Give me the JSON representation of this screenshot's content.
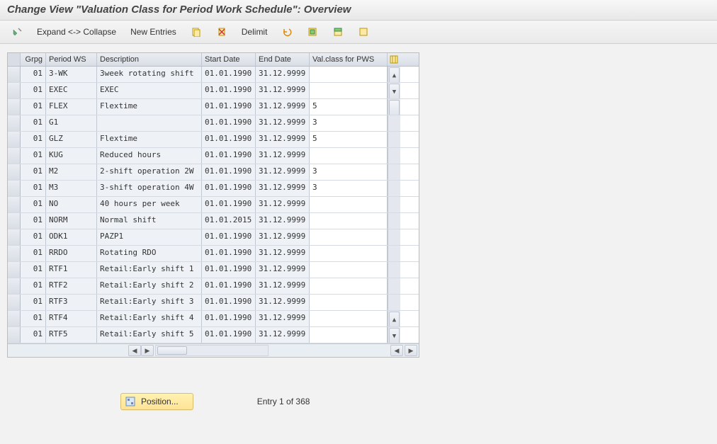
{
  "title": "Change View \"Valuation Class for Period Work Schedule\": Overview",
  "toolbar": {
    "expand_collapse": "Expand <-> Collapse",
    "new_entries": "New Entries",
    "delimit": "Delimit"
  },
  "columns": {
    "grpg": "Grpg",
    "period_ws": "Period WS",
    "description": "Description",
    "start_date": "Start Date",
    "end_date": "End Date",
    "val_class": "Val.class for PWS"
  },
  "rows": [
    {
      "grpg": "01",
      "pws": "3-WK",
      "desc": "3week rotating shift",
      "start": "01.01.1990",
      "end": "31.12.9999",
      "val": ""
    },
    {
      "grpg": "01",
      "pws": "EXEC",
      "desc": "EXEC",
      "start": "01.01.1990",
      "end": "31.12.9999",
      "val": ""
    },
    {
      "grpg": "01",
      "pws": "FLEX",
      "desc": "Flextime",
      "start": "01.01.1990",
      "end": "31.12.9999",
      "val": "5"
    },
    {
      "grpg": "01",
      "pws": "G1",
      "desc": "",
      "start": "01.01.1990",
      "end": "31.12.9999",
      "val": "3"
    },
    {
      "grpg": "01",
      "pws": "GLZ",
      "desc": "Flextime",
      "start": "01.01.1990",
      "end": "31.12.9999",
      "val": "5"
    },
    {
      "grpg": "01",
      "pws": "KUG",
      "desc": "Reduced hours",
      "start": "01.01.1990",
      "end": "31.12.9999",
      "val": ""
    },
    {
      "grpg": "01",
      "pws": "M2",
      "desc": "2-shift operation 2W",
      "start": "01.01.1990",
      "end": "31.12.9999",
      "val": "3"
    },
    {
      "grpg": "01",
      "pws": "M3",
      "desc": "3-shift operation 4W",
      "start": "01.01.1990",
      "end": "31.12.9999",
      "val": "3"
    },
    {
      "grpg": "01",
      "pws": "NO",
      "desc": "40 hours per week",
      "start": "01.01.1990",
      "end": "31.12.9999",
      "val": ""
    },
    {
      "grpg": "01",
      "pws": "NORM",
      "desc": "Normal shift",
      "start": "01.01.2015",
      "end": "31.12.9999",
      "val": ""
    },
    {
      "grpg": "01",
      "pws": "ODK1",
      "desc": "PAZP1",
      "start": "01.01.1990",
      "end": "31.12.9999",
      "val": ""
    },
    {
      "grpg": "01",
      "pws": "RRDO",
      "desc": "Rotating RDO",
      "start": "01.01.1990",
      "end": "31.12.9999",
      "val": ""
    },
    {
      "grpg": "01",
      "pws": "RTF1",
      "desc": "Retail:Early shift 1",
      "start": "01.01.1990",
      "end": "31.12.9999",
      "val": ""
    },
    {
      "grpg": "01",
      "pws": "RTF2",
      "desc": "Retail:Early shift 2",
      "start": "01.01.1990",
      "end": "31.12.9999",
      "val": ""
    },
    {
      "grpg": "01",
      "pws": "RTF3",
      "desc": "Retail:Early shift 3",
      "start": "01.01.1990",
      "end": "31.12.9999",
      "val": ""
    },
    {
      "grpg": "01",
      "pws": "RTF4",
      "desc": "Retail:Early shift 4",
      "start": "01.01.1990",
      "end": "31.12.9999",
      "val": ""
    },
    {
      "grpg": "01",
      "pws": "RTF5",
      "desc": "Retail:Early shift 5",
      "start": "01.01.1990",
      "end": "31.12.9999",
      "val": ""
    }
  ],
  "footer": {
    "position": "Position...",
    "entry": "Entry 1 of 368"
  }
}
